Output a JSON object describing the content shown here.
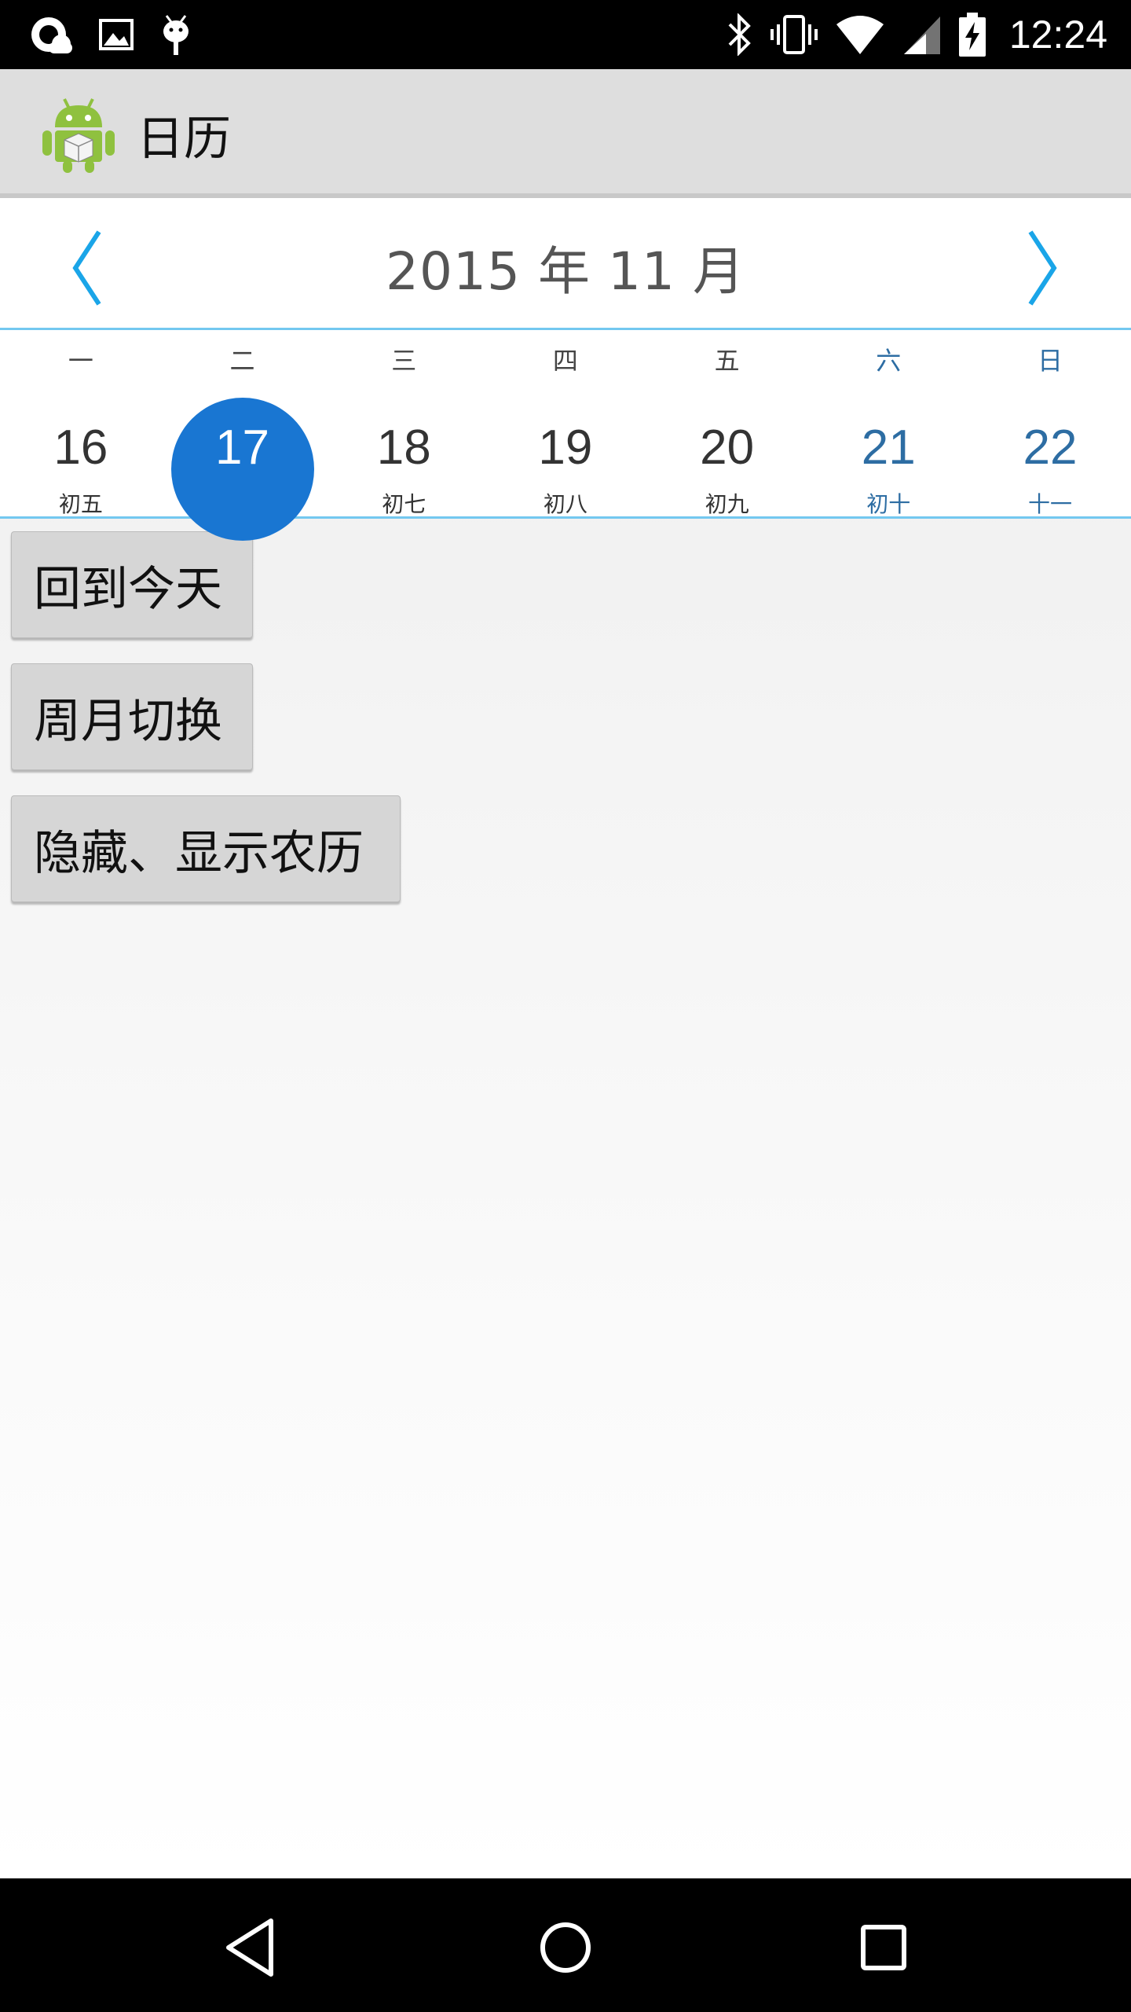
{
  "status_bar": {
    "time": "12:24",
    "left_icons": [
      "cloud-icon",
      "image-icon",
      "android-debug-icon"
    ],
    "right_icons": [
      "bluetooth-icon",
      "vibrate-icon",
      "wifi-icon",
      "signal-icon",
      "battery-charging-icon"
    ]
  },
  "app_bar": {
    "title": "日历",
    "icon": "android-app-icon"
  },
  "calendar": {
    "month_title": "2015 年 11 月",
    "prev_icon": "chevron-left-icon",
    "next_icon": "chevron-right-icon",
    "accent_color": "#1976d2",
    "weekend_color": "#2d6da3",
    "weekdays": [
      "一",
      "二",
      "三",
      "四",
      "五",
      "六",
      "日"
    ],
    "days": [
      {
        "num": "16",
        "lunar": "初五",
        "weekend": false,
        "selected": false
      },
      {
        "num": "17",
        "lunar": "",
        "weekend": false,
        "selected": true
      },
      {
        "num": "18",
        "lunar": "初七",
        "weekend": false,
        "selected": false
      },
      {
        "num": "19",
        "lunar": "初八",
        "weekend": false,
        "selected": false
      },
      {
        "num": "20",
        "lunar": "初九",
        "weekend": false,
        "selected": false
      },
      {
        "num": "21",
        "lunar": "初十",
        "weekend": true,
        "selected": false
      },
      {
        "num": "22",
        "lunar": "十一",
        "weekend": true,
        "selected": false
      }
    ]
  },
  "buttons": {
    "today": "回到今天",
    "switch_mode": "周月切换",
    "toggle_lunar": "隐藏、显示农历"
  },
  "nav_bar": {
    "back_icon": "back-triangle-icon",
    "home_icon": "home-circle-icon",
    "recent_icon": "recent-apps-square-icon"
  }
}
